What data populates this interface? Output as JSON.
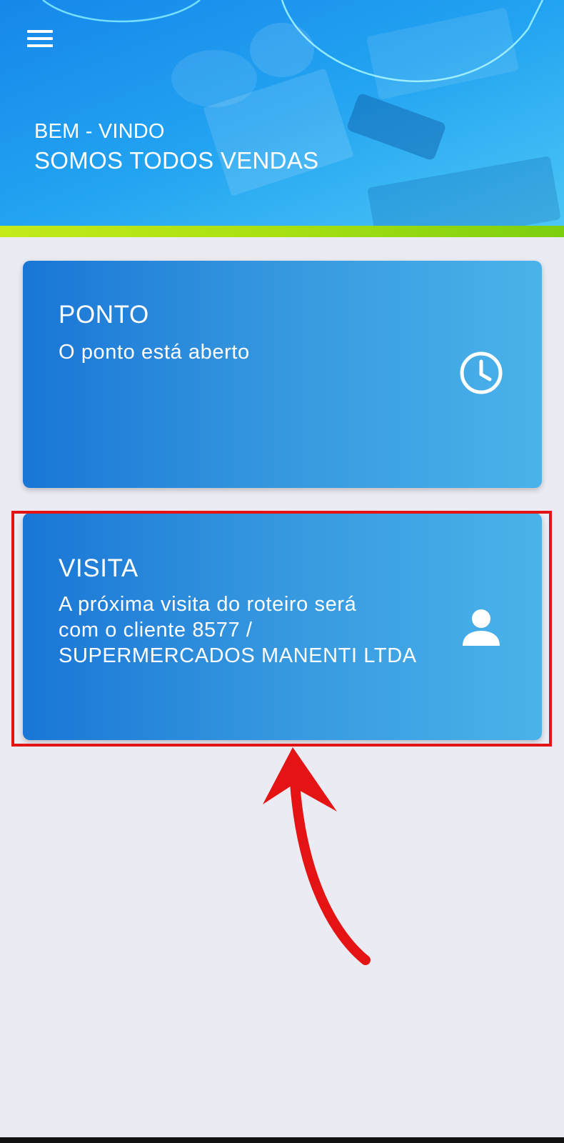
{
  "header": {
    "welcome": "BEM - VINDO",
    "slogan": "SOMOS TODOS VENDAS",
    "menu_icon": "hamburger-menu-icon"
  },
  "cards": {
    "ponto": {
      "title": "PONTO",
      "text": "O ponto está aberto",
      "icon": "clock-icon"
    },
    "visita": {
      "title": "VISITA",
      "text": "A próxima visita do roteiro será\ncom o cliente 8577 /\nSUPERMERCADOS MANENTI LTDA",
      "icon": "person-icon"
    }
  },
  "annotation": {
    "highlight_color": "#e51414",
    "arrow_color": "#e51414"
  },
  "colors": {
    "card_start": "#1976d6",
    "card_end": "#4ab3ea",
    "accent_bar": "#a8e012",
    "background": "#ebebf3"
  }
}
